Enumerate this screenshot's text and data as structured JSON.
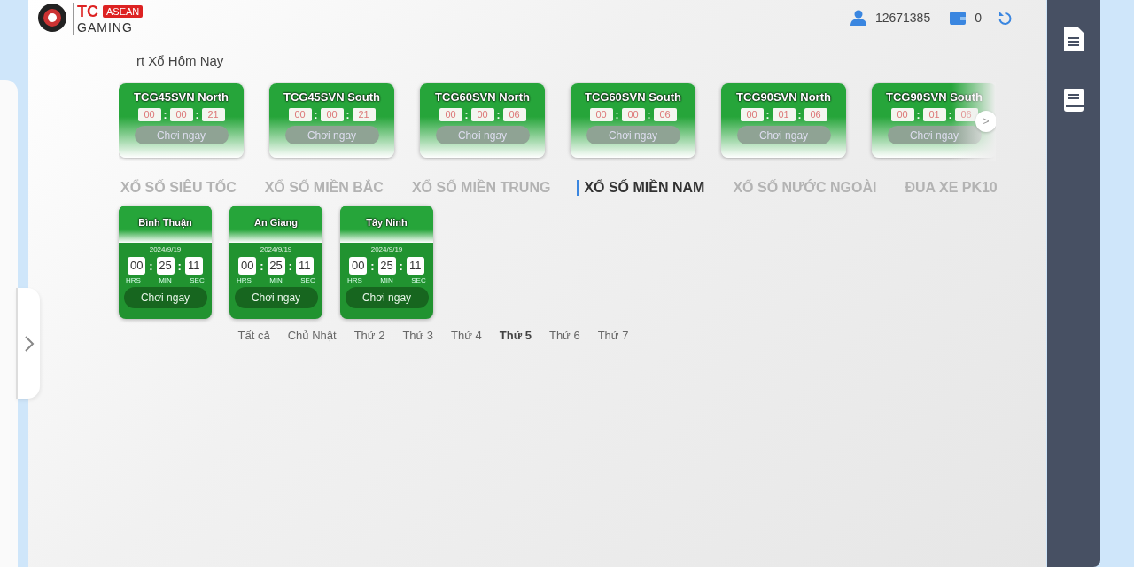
{
  "logo": {
    "brand": "TC",
    "badge": "ASEAN",
    "sub": "GAMING"
  },
  "header": {
    "user_id": "12671385",
    "balance": "0"
  },
  "section_title": "rt Xổ Hôm Nay",
  "featured": [
    {
      "name": "TCG45SVN North",
      "separator": ":",
      "time": [
        "00",
        "00",
        "21"
      ],
      "button": "Chơi ngay"
    },
    {
      "name": "TCG45SVN South",
      "separator": ":",
      "time": [
        "00",
        "00",
        "21"
      ],
      "button": "Chơi ngay"
    },
    {
      "name": "TCG60SVN North",
      "separator": ":",
      "time": [
        "00",
        "00",
        "06"
      ],
      "button": "Chơi ngay"
    },
    {
      "name": "TCG60SVN South",
      "separator": ":",
      "time": [
        "00",
        "00",
        "06"
      ],
      "button": "Chơi ngay"
    },
    {
      "name": "TCG90SVN North",
      "separator": ":",
      "time": [
        "00",
        "01",
        "06"
      ],
      "button": "Chơi ngay"
    },
    {
      "name": "TCG90SVN South",
      "separator": ":",
      "time": [
        "00",
        "01",
        "06"
      ],
      "button": "Chơi ngay"
    }
  ],
  "next_button": ">",
  "tabs": [
    {
      "label": "XỔ SỐ SIÊU TỐC",
      "selected": false
    },
    {
      "label": "XỔ SỐ MIỀN BẮC",
      "selected": false
    },
    {
      "label": "XỔ SỐ MIỀN TRUNG",
      "selected": false
    },
    {
      "label": "XỔ SỐ MIỀN NAM",
      "selected": true
    },
    {
      "label": "XỔ SỐ NƯỚC NGOÀI",
      "selected": false
    },
    {
      "label": "ĐUA XE PK10",
      "selected": false
    }
  ],
  "games": [
    {
      "name": "Bình Thuận",
      "date": "2024/9/19",
      "separator": ":",
      "time": [
        "00",
        "25",
        "11"
      ],
      "units": [
        "HRS",
        "MIN",
        "SEC"
      ],
      "button": "Chơi ngay"
    },
    {
      "name": "An Giang",
      "date": "2024/9/19",
      "separator": ":",
      "time": [
        "00",
        "25",
        "11"
      ],
      "units": [
        "HRS",
        "MIN",
        "SEC"
      ],
      "button": "Chơi ngay"
    },
    {
      "name": "Tây Ninh",
      "date": "2024/9/19",
      "separator": ":",
      "time": [
        "00",
        "25",
        "11"
      ],
      "units": [
        "HRS",
        "MIN",
        "SEC"
      ],
      "button": "Chơi ngay"
    }
  ],
  "days": [
    {
      "label": "Tất cả",
      "selected": false
    },
    {
      "label": "Chủ Nhật",
      "selected": false
    },
    {
      "label": "Thứ 2",
      "selected": false
    },
    {
      "label": "Thứ 3",
      "selected": false
    },
    {
      "label": "Thứ 4",
      "selected": false
    },
    {
      "label": "Thứ 5",
      "selected": true
    },
    {
      "label": "Thứ 6",
      "selected": false
    },
    {
      "label": "Thứ 7",
      "selected": false
    }
  ]
}
